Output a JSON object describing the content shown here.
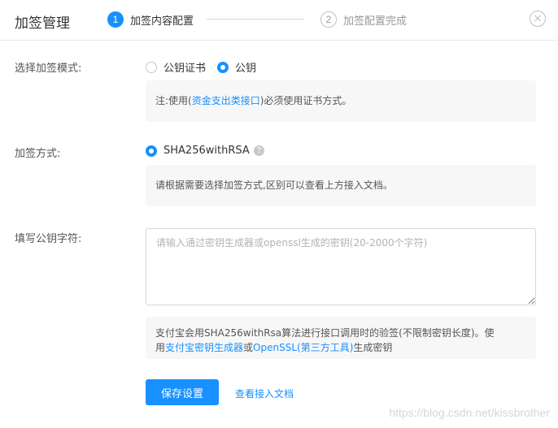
{
  "header": {
    "title": "加签管理",
    "steps": [
      {
        "num": "1",
        "label": "加签内容配置"
      },
      {
        "num": "2",
        "label": "加签配置完成"
      }
    ],
    "close_symbol": "×"
  },
  "mode": {
    "label": "选择加签模式:",
    "options": [
      {
        "label": "公钥证书",
        "checked": false
      },
      {
        "label": "公钥",
        "checked": true
      }
    ],
    "note": {
      "prefix": "注:使用(",
      "link": "资金支出类接口",
      "suffix": ")必须使用证书方式。"
    }
  },
  "method": {
    "label": "加签方式:",
    "option": "SHA256withRSA",
    "help_symbol": "?",
    "note": "请根据需要选择加签方式,区别可以查看上方接入文档。"
  },
  "pubkey": {
    "label": "填写公钥字符:",
    "placeholder": "请输入通过密钥生成器或openssl生成的密钥(20-2000个字符)",
    "note": {
      "line1": "支付宝会用SHA256withRsa算法进行接口调用时的验签(不限制密钥长度)。使",
      "prefix": "用",
      "link1": "支付宝密钥生成器",
      "mid": "或",
      "link2": "OpenSSL(第三方工具)",
      "suffix": "生成密钥"
    }
  },
  "footer": {
    "save_label": "保存设置",
    "docs_label": "查看接入文档",
    "watermark": "https://blog.csdn.net/kissbrother"
  },
  "colors": {
    "accent": "#1890ff",
    "note_bg": "#f7f7f7"
  }
}
